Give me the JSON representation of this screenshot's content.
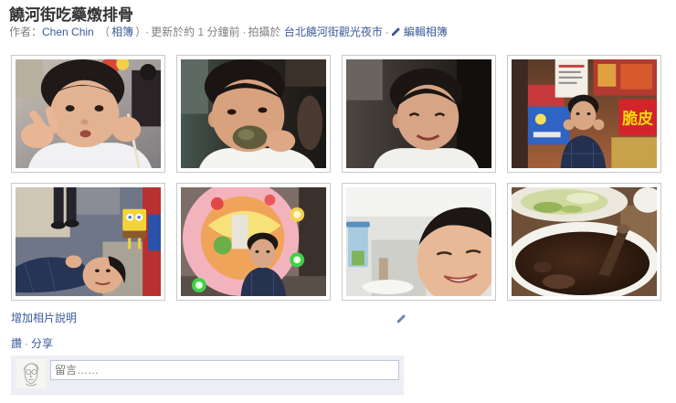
{
  "album": {
    "title": "饒河街吃藥燉排骨",
    "meta": {
      "author_prefix": "作者：",
      "author_name": "Chen Chin",
      "paren_open": "（",
      "albums_link": "相簿",
      "paren_close": "）",
      "separator": "·",
      "updated": "更新於約 1 分鐘前",
      "taken_at_prefix": "拍攝於",
      "location": "台北饒河街觀光夜市",
      "edit_album": "編輯相簿"
    }
  },
  "photos": {
    "photo_4_sign_text": "脆皮"
  },
  "caption": {
    "add_caption": "增加相片說明"
  },
  "actions": {
    "like": "讚",
    "separator": "·",
    "share": "分享"
  },
  "comment": {
    "placeholder": "留言……"
  },
  "icons": {
    "edit_album": "pencil-icon",
    "edit_caption": "pencil-icon"
  },
  "colors": {
    "title": "#333333",
    "link": "#3b5998",
    "meta_text": "#808080",
    "thumb_border": "#c9c9c9",
    "composer_bg": "#edeff4",
    "input_border": "#bdc7d8"
  }
}
